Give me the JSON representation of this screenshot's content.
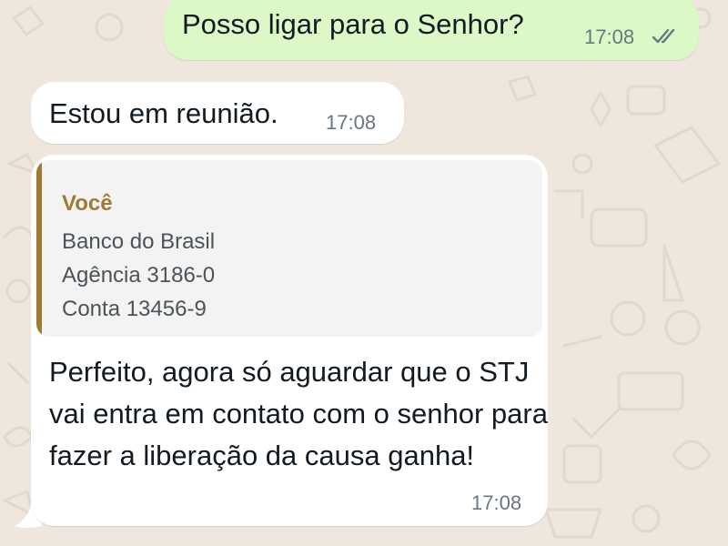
{
  "colors": {
    "outgoing_bubble": "#dcf8c6",
    "incoming_bubble": "#ffffff",
    "quote_accent": "#9f7a34",
    "read_ticks": "#667781",
    "wallpaper": "#efe7dd"
  },
  "messages": [
    {
      "direction": "outgoing",
      "text": "Posso ligar para o Senhor?",
      "time": "17:08",
      "status_icon": "double-check-icon"
    },
    {
      "direction": "incoming",
      "text": "Estou em reunião.",
      "time": "17:08"
    },
    {
      "direction": "incoming",
      "quoted": {
        "author": "Você",
        "lines": [
          "Banco do Brasil",
          "Agência 3186-0",
          "Conta 13456-9"
        ]
      },
      "text": "Perfeito, agora só aguardar que o STJ vai entra em contato com o senhor para fazer a liberação da causa ganha!",
      "time": "17:08"
    }
  ]
}
